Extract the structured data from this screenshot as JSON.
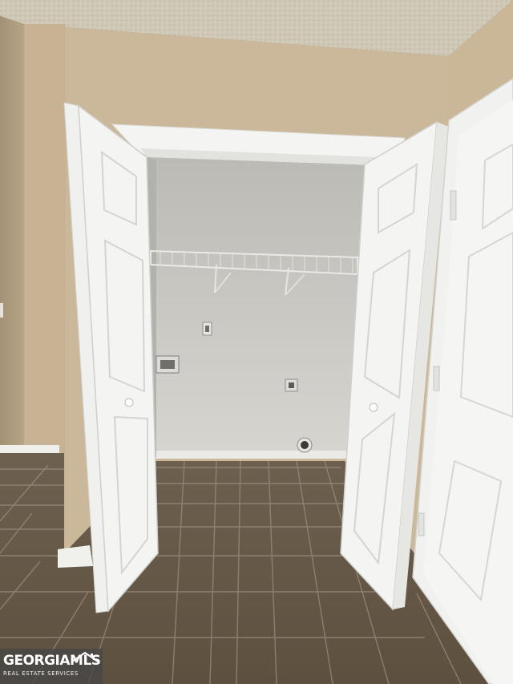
{
  "watermark": {
    "brand": "GEORGIAMLS",
    "tagline": "REAL ESTATE SERVICES",
    "icon": "house-roof-icon"
  },
  "colors": {
    "wall": "#cbb89a",
    "closet_wall": "#c9c8c3",
    "ceiling": "#cdc6b4",
    "door": "#f3f3f1",
    "floor": "#6b5c4b",
    "grout": "#a39a8c",
    "watermark_bg": "#464646"
  }
}
